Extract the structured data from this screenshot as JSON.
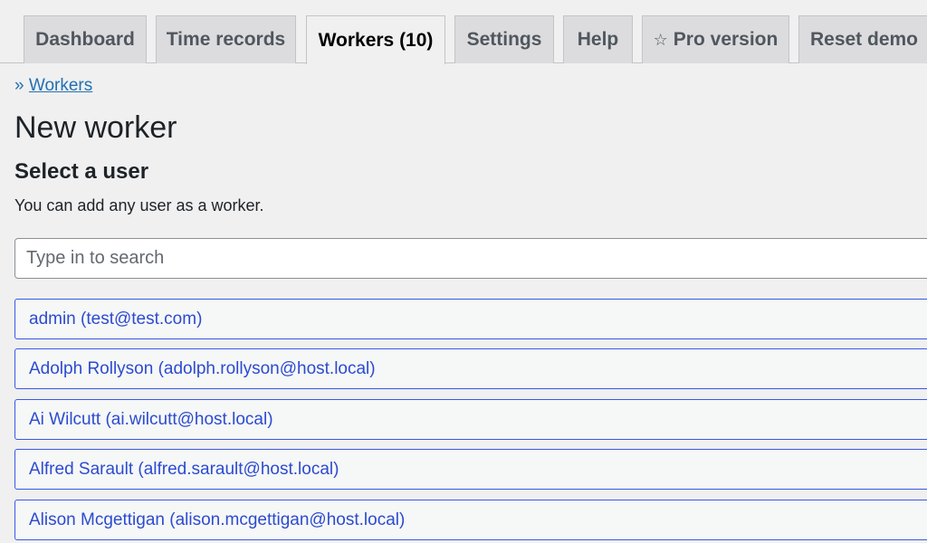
{
  "tabs": [
    {
      "label": "Dashboard",
      "active": false
    },
    {
      "label": "Time records",
      "active": false
    },
    {
      "label": "Workers (10)",
      "active": true
    },
    {
      "label": "Settings",
      "active": false
    },
    {
      "label": "Help",
      "active": false
    },
    {
      "label": "Pro version",
      "icon": "star-icon",
      "active": false
    },
    {
      "label": "Reset demo",
      "active": false
    }
  ],
  "breadcrumb": {
    "prefix": "»",
    "link": "Workers"
  },
  "page_title": "New worker",
  "section_title": "Select a user",
  "description": "You can add any user as a worker.",
  "search": {
    "placeholder": "Type in to search",
    "value": ""
  },
  "users": [
    "admin (test@test.com)",
    "Adolph Rollyson (adolph.rollyson@host.local)",
    "Ai Wilcutt (ai.wilcutt@host.local)",
    "Alfred Sarault (alfred.sarault@host.local)",
    "Alison Mcgettigan (alison.mcgettigan@host.local)"
  ],
  "colors": {
    "accent": "#3858e9",
    "link": "#2271b1",
    "background": "#f0f0f1"
  }
}
